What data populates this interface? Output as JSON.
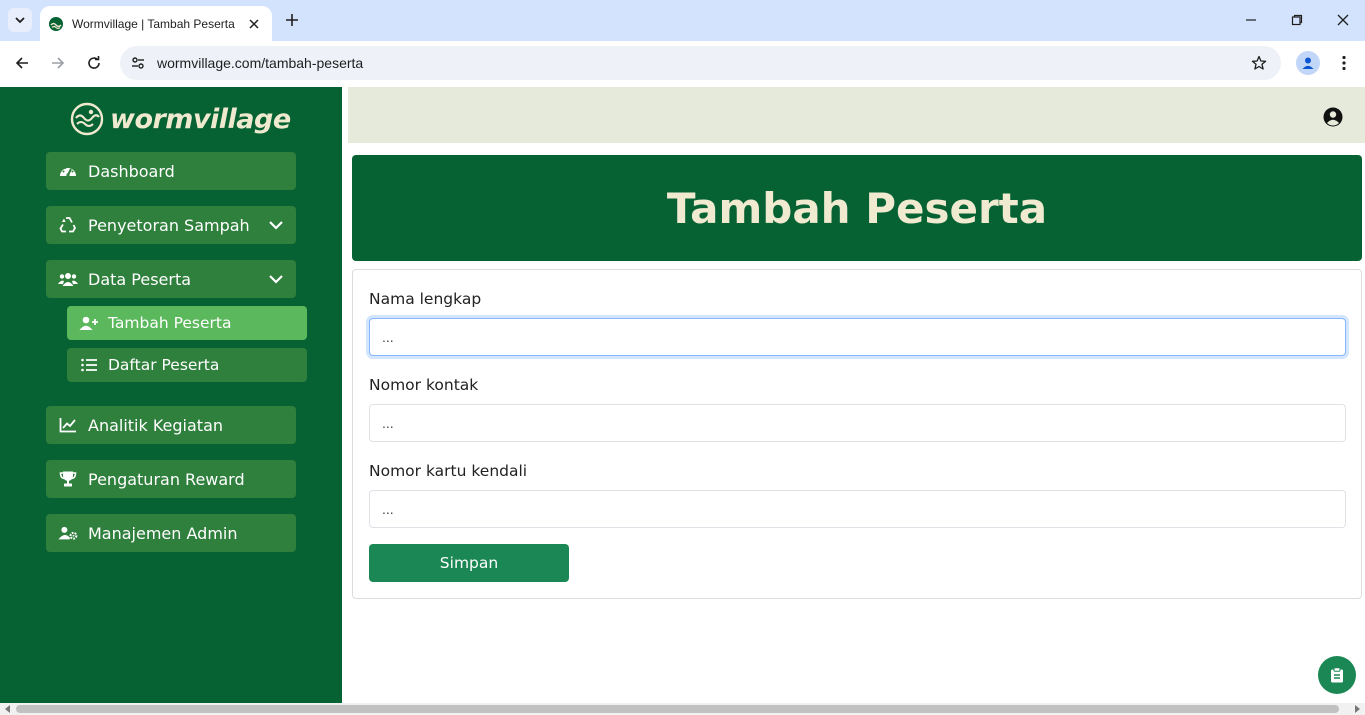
{
  "browser": {
    "tab_title": "Wormvillage | Tambah Peserta",
    "url": "wormvillage.com/tambah-peserta"
  },
  "app": {
    "logo_text": "wormvillage",
    "colors": {
      "sidebar": "#066233",
      "menu_item": "#2f7f3d",
      "active_item": "#5cb85c",
      "accent": "#1a8754",
      "topbar": "#e6eadb"
    }
  },
  "sidebar": {
    "items": [
      {
        "label": "Dashboard",
        "icon": "gauge-icon"
      },
      {
        "label": "Penyetoran Sampah",
        "icon": "recycle-icon",
        "has_submenu": true
      },
      {
        "label": "Data Peserta",
        "icon": "users-icon",
        "has_submenu": true
      },
      {
        "label": "Analitik Kegiatan",
        "icon": "chart-line-icon"
      },
      {
        "label": "Pengaturan Reward",
        "icon": "trophy-icon"
      },
      {
        "label": "Manajemen Admin",
        "icon": "user-gear-icon"
      }
    ],
    "subitems": [
      {
        "label": "Tambah Peserta",
        "icon": "user-plus-icon",
        "active": true
      },
      {
        "label": "Daftar Peserta",
        "icon": "list-icon",
        "active": false
      }
    ]
  },
  "main": {
    "title": "Tambah Peserta",
    "form": {
      "fields": [
        {
          "label": "Nama lengkap",
          "placeholder": "...",
          "value": ""
        },
        {
          "label": "Nomor kontak",
          "placeholder": "...",
          "value": ""
        },
        {
          "label": "Nomor kartu kendali",
          "placeholder": "...",
          "value": ""
        }
      ],
      "submit_label": "Simpan"
    }
  }
}
